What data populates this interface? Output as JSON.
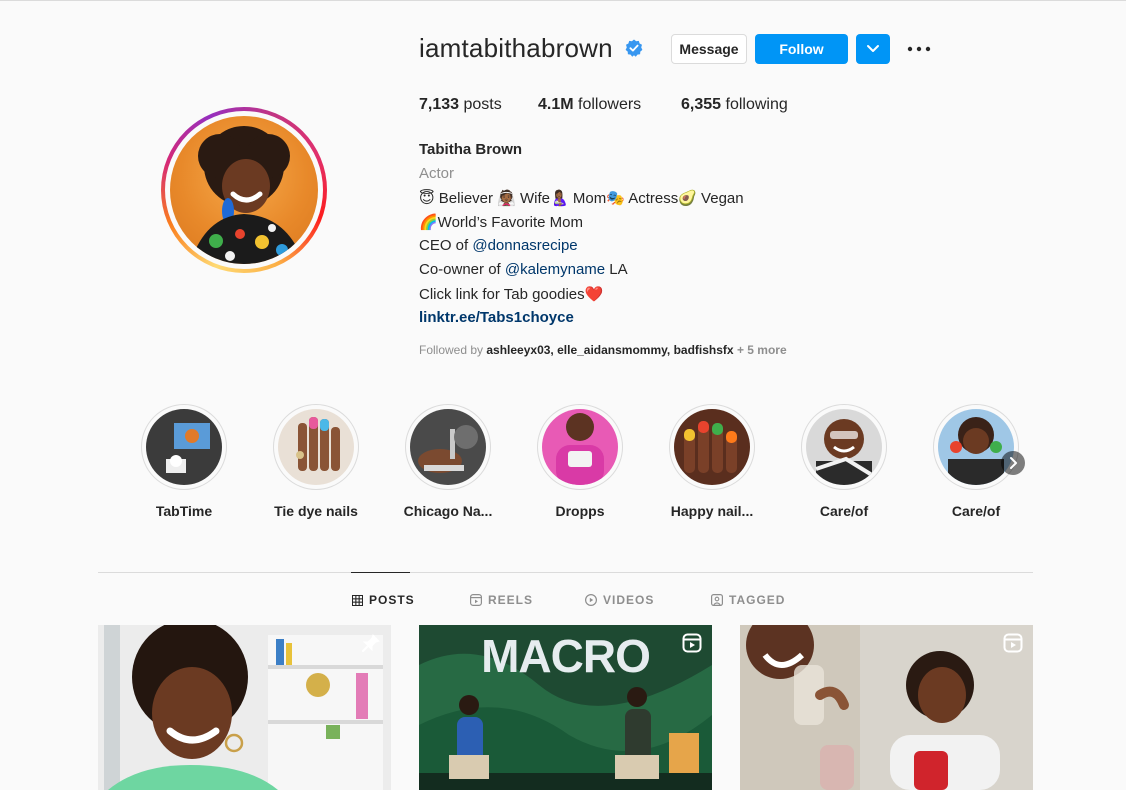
{
  "profile": {
    "username": "iamtabithabrown",
    "verified": true,
    "buttons": {
      "message": "Message",
      "follow": "Follow"
    },
    "stats": {
      "posts_count": "7,133",
      "posts_label": "posts",
      "followers_count": "4.1M",
      "followers_label": "followers",
      "following_count": "6,355",
      "following_label": "following"
    },
    "full_name": "Tabitha Brown",
    "category": "Actor",
    "bio": {
      "line1": "😇 Believer 👰🏾 Wife🤱🏾 Mom🎭 Actress🥑 Vegan",
      "line2": "🌈World’s Favorite Mom",
      "line3_prefix": "CEO of ",
      "line3_mention": "@donnasrecipe",
      "line4_prefix": "Co-owner of ",
      "line4_mention": "@kalemyname",
      "line4_suffix": " LA",
      "line5": "Click link for Tab goodies❤️"
    },
    "link": "linktr.ee/Tabs1choyce",
    "followed_by": {
      "prefix": "Followed by ",
      "names": "ashleeyx03, elle_aidansmommy, badfishsfx",
      "more": " + 5 more"
    }
  },
  "highlights": [
    {
      "label": "TabTime"
    },
    {
      "label": "Tie dye nails"
    },
    {
      "label": "Chicago Na..."
    },
    {
      "label": "Dropps"
    },
    {
      "label": "Happy nail..."
    },
    {
      "label": "Care/of"
    },
    {
      "label": "Care/of"
    }
  ],
  "tabs": [
    {
      "label": "POSTS",
      "icon": "grid-icon",
      "active": true
    },
    {
      "label": "REELS",
      "icon": "reels-icon",
      "active": false
    },
    {
      "label": "VIDEOS",
      "icon": "video-icon",
      "active": false
    },
    {
      "label": "TAGGED",
      "icon": "tagged-icon",
      "active": false
    }
  ],
  "posts": [
    {
      "type": "pinned",
      "icon": "pin-icon"
    },
    {
      "type": "reel",
      "icon": "reel-icon",
      "overlay_text": "MACRO"
    },
    {
      "type": "reel",
      "icon": "reel-icon"
    }
  ],
  "colors": {
    "accent": "#0095f6",
    "verified": "#3897f0",
    "mention": "#00376b",
    "muted": "#8e8e8e",
    "background": "#fafafa"
  }
}
